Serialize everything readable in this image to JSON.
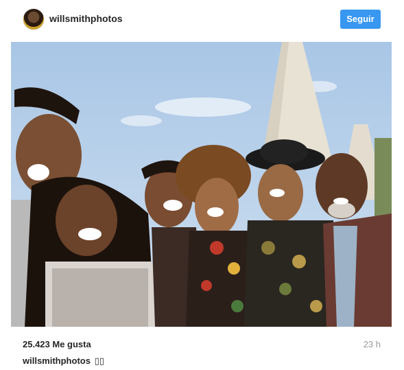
{
  "post": {
    "username": "willsmithphotos",
    "follow_label": "Seguir",
    "likes_text": "25.423 Me gusta",
    "timestamp": "23 h",
    "caption_user": "willsmithphotos",
    "caption_text": "▯▯"
  },
  "icons": {
    "avatar": "profile-avatar"
  }
}
